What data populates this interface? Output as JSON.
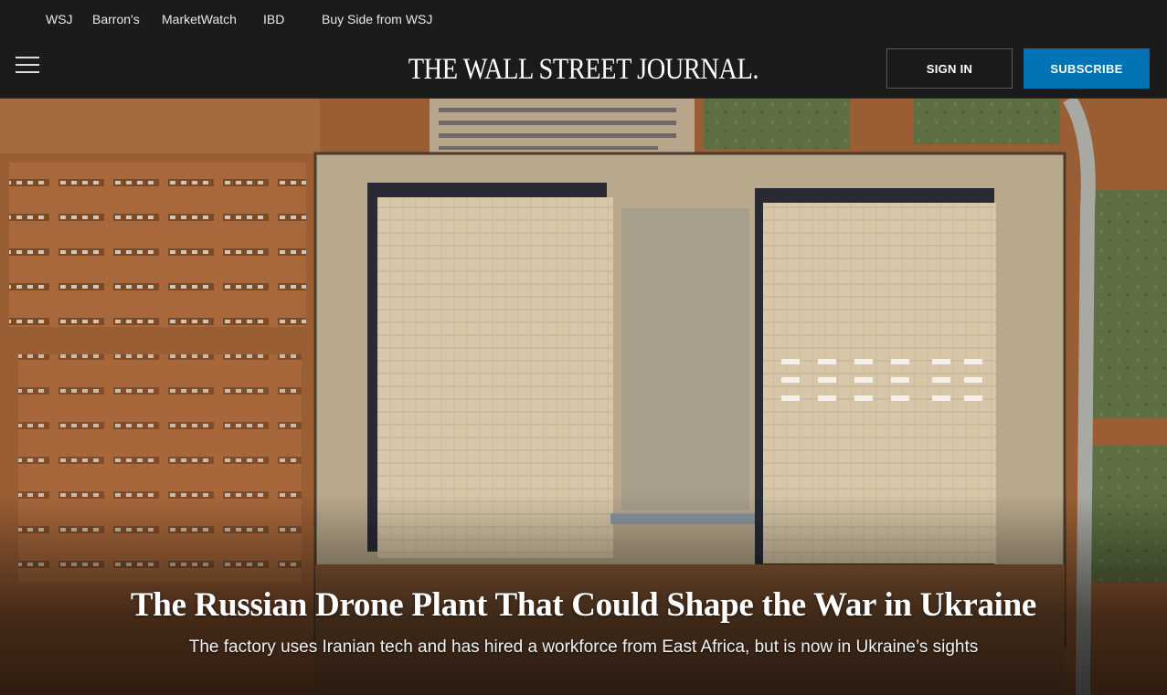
{
  "network_nav": [
    "WSJ",
    "Barron's",
    "MarketWatch",
    "IBD",
    "Buy Side from WSJ"
  ],
  "masthead": {
    "logo": "THE WALL STREET JOURNAL.",
    "menu_icon": "hamburger-menu-icon",
    "sign_in": "SIGN IN",
    "subscribe": "SUBSCRIBE"
  },
  "colors": {
    "header_bg": "#1b1b1b",
    "subscribe_bg": "#0274b6",
    "text": "#ffffff"
  },
  "hero": {
    "image": "satellite view of factory complex",
    "headline": "The Russian Drone Plant That Could Shape the War in Ukraine",
    "dek": "The factory uses Iranian tech and has hired a workforce from East Africa, but is now in Ukraine’s sights"
  }
}
